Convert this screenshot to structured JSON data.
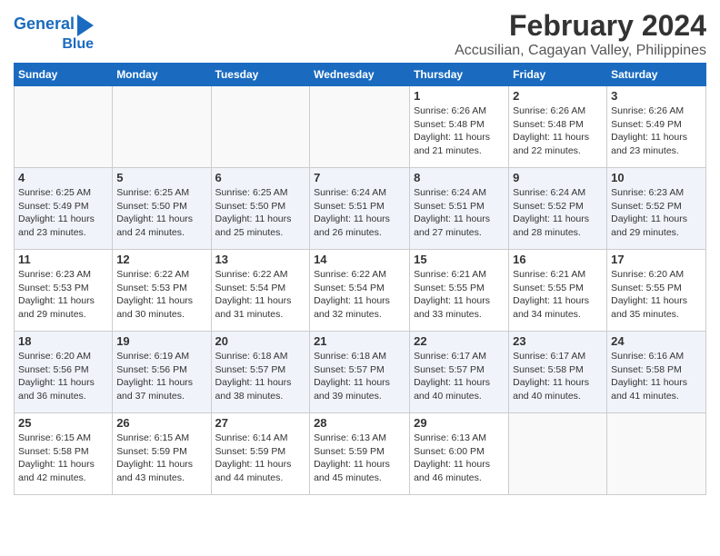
{
  "logo": {
    "line1": "General",
    "line2": "Blue"
  },
  "title": "February 2024",
  "subtitle": "Accusilian, Cagayan Valley, Philippines",
  "days_of_week": [
    "Sunday",
    "Monday",
    "Tuesday",
    "Wednesday",
    "Thursday",
    "Friday",
    "Saturday"
  ],
  "weeks": [
    [
      {
        "num": "",
        "info": ""
      },
      {
        "num": "",
        "info": ""
      },
      {
        "num": "",
        "info": ""
      },
      {
        "num": "",
        "info": ""
      },
      {
        "num": "1",
        "info": "Sunrise: 6:26 AM\nSunset: 5:48 PM\nDaylight: 11 hours\nand 21 minutes."
      },
      {
        "num": "2",
        "info": "Sunrise: 6:26 AM\nSunset: 5:48 PM\nDaylight: 11 hours\nand 22 minutes."
      },
      {
        "num": "3",
        "info": "Sunrise: 6:26 AM\nSunset: 5:49 PM\nDaylight: 11 hours\nand 23 minutes."
      }
    ],
    [
      {
        "num": "4",
        "info": "Sunrise: 6:25 AM\nSunset: 5:49 PM\nDaylight: 11 hours\nand 23 minutes."
      },
      {
        "num": "5",
        "info": "Sunrise: 6:25 AM\nSunset: 5:50 PM\nDaylight: 11 hours\nand 24 minutes."
      },
      {
        "num": "6",
        "info": "Sunrise: 6:25 AM\nSunset: 5:50 PM\nDaylight: 11 hours\nand 25 minutes."
      },
      {
        "num": "7",
        "info": "Sunrise: 6:24 AM\nSunset: 5:51 PM\nDaylight: 11 hours\nand 26 minutes."
      },
      {
        "num": "8",
        "info": "Sunrise: 6:24 AM\nSunset: 5:51 PM\nDaylight: 11 hours\nand 27 minutes."
      },
      {
        "num": "9",
        "info": "Sunrise: 6:24 AM\nSunset: 5:52 PM\nDaylight: 11 hours\nand 28 minutes."
      },
      {
        "num": "10",
        "info": "Sunrise: 6:23 AM\nSunset: 5:52 PM\nDaylight: 11 hours\nand 29 minutes."
      }
    ],
    [
      {
        "num": "11",
        "info": "Sunrise: 6:23 AM\nSunset: 5:53 PM\nDaylight: 11 hours\nand 29 minutes."
      },
      {
        "num": "12",
        "info": "Sunrise: 6:22 AM\nSunset: 5:53 PM\nDaylight: 11 hours\nand 30 minutes."
      },
      {
        "num": "13",
        "info": "Sunrise: 6:22 AM\nSunset: 5:54 PM\nDaylight: 11 hours\nand 31 minutes."
      },
      {
        "num": "14",
        "info": "Sunrise: 6:22 AM\nSunset: 5:54 PM\nDaylight: 11 hours\nand 32 minutes."
      },
      {
        "num": "15",
        "info": "Sunrise: 6:21 AM\nSunset: 5:55 PM\nDaylight: 11 hours\nand 33 minutes."
      },
      {
        "num": "16",
        "info": "Sunrise: 6:21 AM\nSunset: 5:55 PM\nDaylight: 11 hours\nand 34 minutes."
      },
      {
        "num": "17",
        "info": "Sunrise: 6:20 AM\nSunset: 5:55 PM\nDaylight: 11 hours\nand 35 minutes."
      }
    ],
    [
      {
        "num": "18",
        "info": "Sunrise: 6:20 AM\nSunset: 5:56 PM\nDaylight: 11 hours\nand 36 minutes."
      },
      {
        "num": "19",
        "info": "Sunrise: 6:19 AM\nSunset: 5:56 PM\nDaylight: 11 hours\nand 37 minutes."
      },
      {
        "num": "20",
        "info": "Sunrise: 6:18 AM\nSunset: 5:57 PM\nDaylight: 11 hours\nand 38 minutes."
      },
      {
        "num": "21",
        "info": "Sunrise: 6:18 AM\nSunset: 5:57 PM\nDaylight: 11 hours\nand 39 minutes."
      },
      {
        "num": "22",
        "info": "Sunrise: 6:17 AM\nSunset: 5:57 PM\nDaylight: 11 hours\nand 40 minutes."
      },
      {
        "num": "23",
        "info": "Sunrise: 6:17 AM\nSunset: 5:58 PM\nDaylight: 11 hours\nand 40 minutes."
      },
      {
        "num": "24",
        "info": "Sunrise: 6:16 AM\nSunset: 5:58 PM\nDaylight: 11 hours\nand 41 minutes."
      }
    ],
    [
      {
        "num": "25",
        "info": "Sunrise: 6:15 AM\nSunset: 5:58 PM\nDaylight: 11 hours\nand 42 minutes."
      },
      {
        "num": "26",
        "info": "Sunrise: 6:15 AM\nSunset: 5:59 PM\nDaylight: 11 hours\nand 43 minutes."
      },
      {
        "num": "27",
        "info": "Sunrise: 6:14 AM\nSunset: 5:59 PM\nDaylight: 11 hours\nand 44 minutes."
      },
      {
        "num": "28",
        "info": "Sunrise: 6:13 AM\nSunset: 5:59 PM\nDaylight: 11 hours\nand 45 minutes."
      },
      {
        "num": "29",
        "info": "Sunrise: 6:13 AM\nSunset: 6:00 PM\nDaylight: 11 hours\nand 46 minutes."
      },
      {
        "num": "",
        "info": ""
      },
      {
        "num": "",
        "info": ""
      }
    ]
  ]
}
